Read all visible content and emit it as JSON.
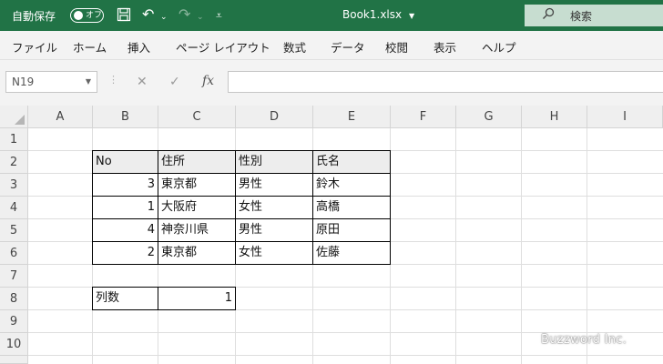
{
  "titlebar": {
    "autosave_label": "自動保存",
    "autosave_state": "オフ",
    "document_title": "Book1.xlsx",
    "search_placeholder": "検索",
    "background_color": "#217346"
  },
  "menubar": {
    "items": [
      "ファイル",
      "ホーム",
      "挿入",
      "ページ レイアウト",
      "数式",
      "データ",
      "校閲",
      "表示",
      "ヘルプ"
    ]
  },
  "formula_bar": {
    "name_box": "N19",
    "cancel_icon": "✕",
    "enter_icon": "✓",
    "fx_label": "fx",
    "formula": ""
  },
  "sheet": {
    "columns": [
      "A",
      "B",
      "C",
      "D",
      "E",
      "F",
      "G",
      "H",
      "I"
    ],
    "rows": [
      "1",
      "2",
      "3",
      "4",
      "5",
      "6",
      "7",
      "8",
      "9",
      "10"
    ],
    "table": {
      "headers": [
        "No",
        "住所",
        "性別",
        "氏名"
      ],
      "rows": [
        [
          "3",
          "東京都",
          "男性",
          "鈴木"
        ],
        [
          "1",
          "大阪府",
          "女性",
          "高橋"
        ],
        [
          "4",
          "神奈川県",
          "男性",
          "原田"
        ],
        [
          "2",
          "東京都",
          "女性",
          "佐藤"
        ]
      ]
    },
    "count_label": "列数",
    "count_value": "1"
  },
  "watermark": "Buzzword Inc."
}
